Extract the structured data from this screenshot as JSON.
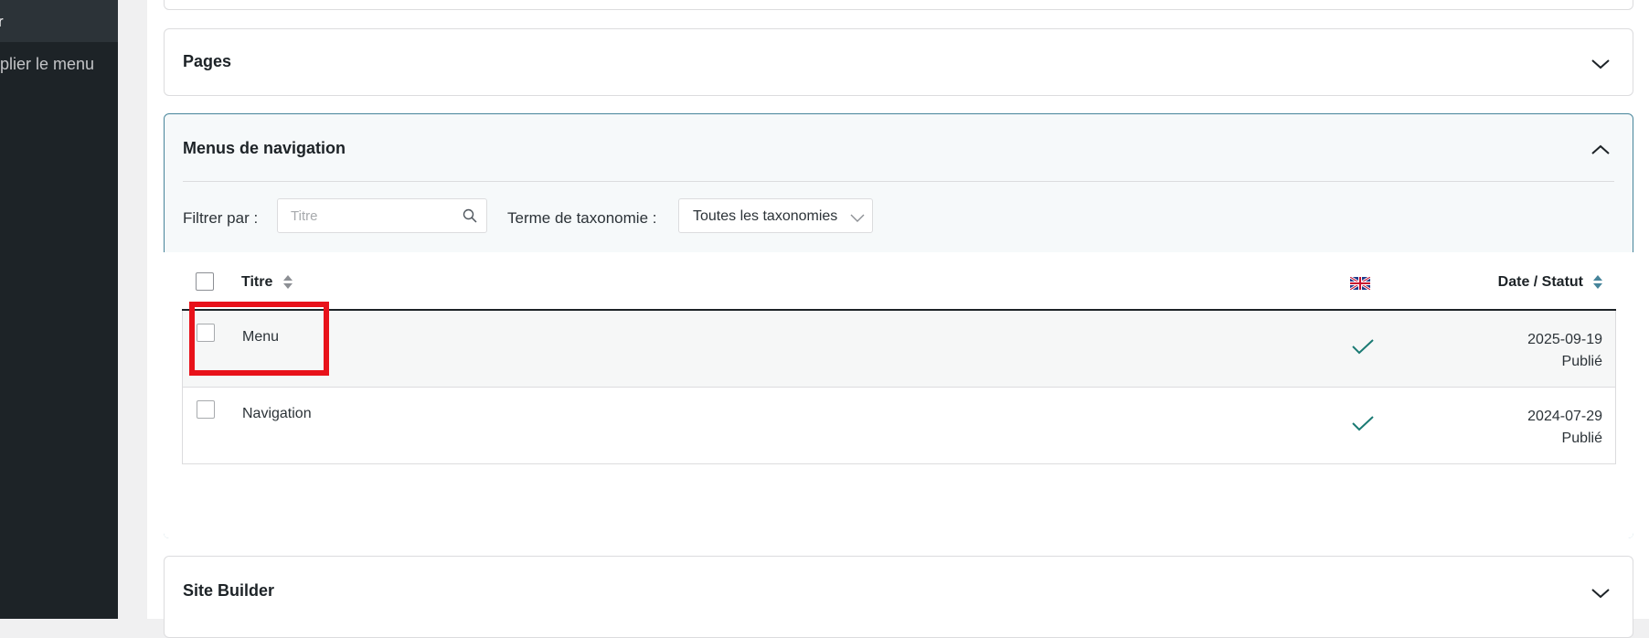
{
  "sidebar": {
    "active_item_fragment": "r",
    "collapse_label": "plier le menu"
  },
  "panels": {
    "pages": {
      "title": "Pages"
    },
    "menus": {
      "title": "Menus de navigation",
      "filter_label": "Filtrer par :",
      "search": {
        "placeholder": "Titre",
        "value": ""
      },
      "taxonomy_label": "Terme de taxonomie :",
      "taxonomy_select": "Toutes les taxonomies",
      "table": {
        "columns": {
          "title": "Titre",
          "language": "gb-flag-icon",
          "date": "Date / Statut"
        },
        "rows": [
          {
            "title": "Menu",
            "date": "2025-09-19",
            "status": "Publié",
            "translated": true
          },
          {
            "title": "Navigation",
            "date": "2024-07-29",
            "status": "Publié",
            "translated": true
          }
        ]
      }
    },
    "site_builder": {
      "title": "Site Builder"
    }
  },
  "colors": {
    "highlight": "#e8121a",
    "accent": "#46849a",
    "sidebar_bg": "#1d2327",
    "check": "#1a7a73"
  }
}
